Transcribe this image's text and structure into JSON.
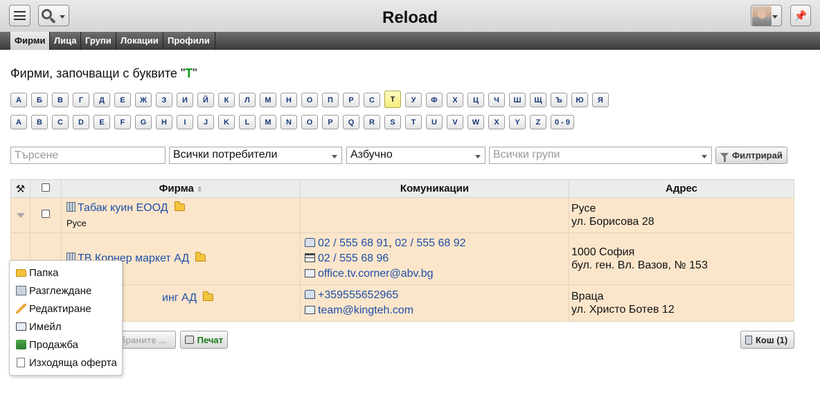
{
  "app": {
    "title": "Reload"
  },
  "tabs": [
    {
      "label": "Фирми",
      "active": true
    },
    {
      "label": "Лица",
      "active": false
    },
    {
      "label": "Групи",
      "active": false
    },
    {
      "label": "Локации",
      "active": false
    },
    {
      "label": "Профили",
      "active": false
    }
  ],
  "heading": {
    "prefix": "Фирми, започващи с буквите \"",
    "letter": "Т",
    "suffix": "\""
  },
  "letters_cyr": [
    "А",
    "Б",
    "В",
    "Г",
    "Д",
    "Е",
    "Ж",
    "З",
    "И",
    "Й",
    "К",
    "Л",
    "М",
    "Н",
    "О",
    "П",
    "Р",
    "С",
    "Т",
    "У",
    "Ф",
    "Х",
    "Ц",
    "Ч",
    "Ш",
    "Щ",
    "Ъ",
    "Ю",
    "Я"
  ],
  "letters_cyr_active": "Т",
  "letters_lat": [
    "A",
    "B",
    "C",
    "D",
    "E",
    "F",
    "G",
    "H",
    "I",
    "J",
    "K",
    "L",
    "M",
    "N",
    "O",
    "P",
    "Q",
    "R",
    "S",
    "T",
    "U",
    "V",
    "W",
    "X",
    "Y",
    "Z",
    "0 - 9"
  ],
  "filters": {
    "search_placeholder": "Търсене",
    "users_value": "Всички потребители",
    "order_value": "Азбучно",
    "groups_placeholder": "Всички групи",
    "filter_label": "Филтрирай"
  },
  "table": {
    "columns": {
      "firm": "Фирма",
      "comm": "Комуникации",
      "address": "Адрес"
    },
    "rows": [
      {
        "name": "Табак куин ЕООД",
        "city": "Русе",
        "phones": [],
        "fax": "",
        "email": "",
        "address1": "Русе",
        "address2": "ул. Борисова 28"
      },
      {
        "name": "ТВ Корнер маркет АД",
        "city": "",
        "phones": [
          "02 / 555 68 91",
          "02 / 555 68 92"
        ],
        "fax": "02 / 555 68 96",
        "email": "office.tv.corner@abv.bg",
        "address1": "1000 София",
        "address2": "бул. ген. Вл. Вазов, № 153"
      },
      {
        "name": "Тех Кинг АД",
        "name_visible": "инг АД",
        "city": "",
        "phones": [
          "+359555652965"
        ],
        "fax": "",
        "email": "team@kingteh.com",
        "address1": "Враца",
        "address2": "ул. Христо Ботев 12"
      }
    ]
  },
  "bottom": {
    "selected_label": "збраните ...",
    "print_label": "Печат",
    "trash_label": "Кош (1)"
  },
  "context_menu": [
    {
      "label": "Папка",
      "icon": "folder-icon"
    },
    {
      "label": "Разглеждане",
      "icon": "view-icon"
    },
    {
      "label": "Редактиране",
      "icon": "edit-icon"
    },
    {
      "label": "Имейл",
      "icon": "mail-icon"
    },
    {
      "label": "Продажба",
      "icon": "sale-icon"
    },
    {
      "label": "Изходяща оферта",
      "icon": "offer-icon"
    }
  ]
}
